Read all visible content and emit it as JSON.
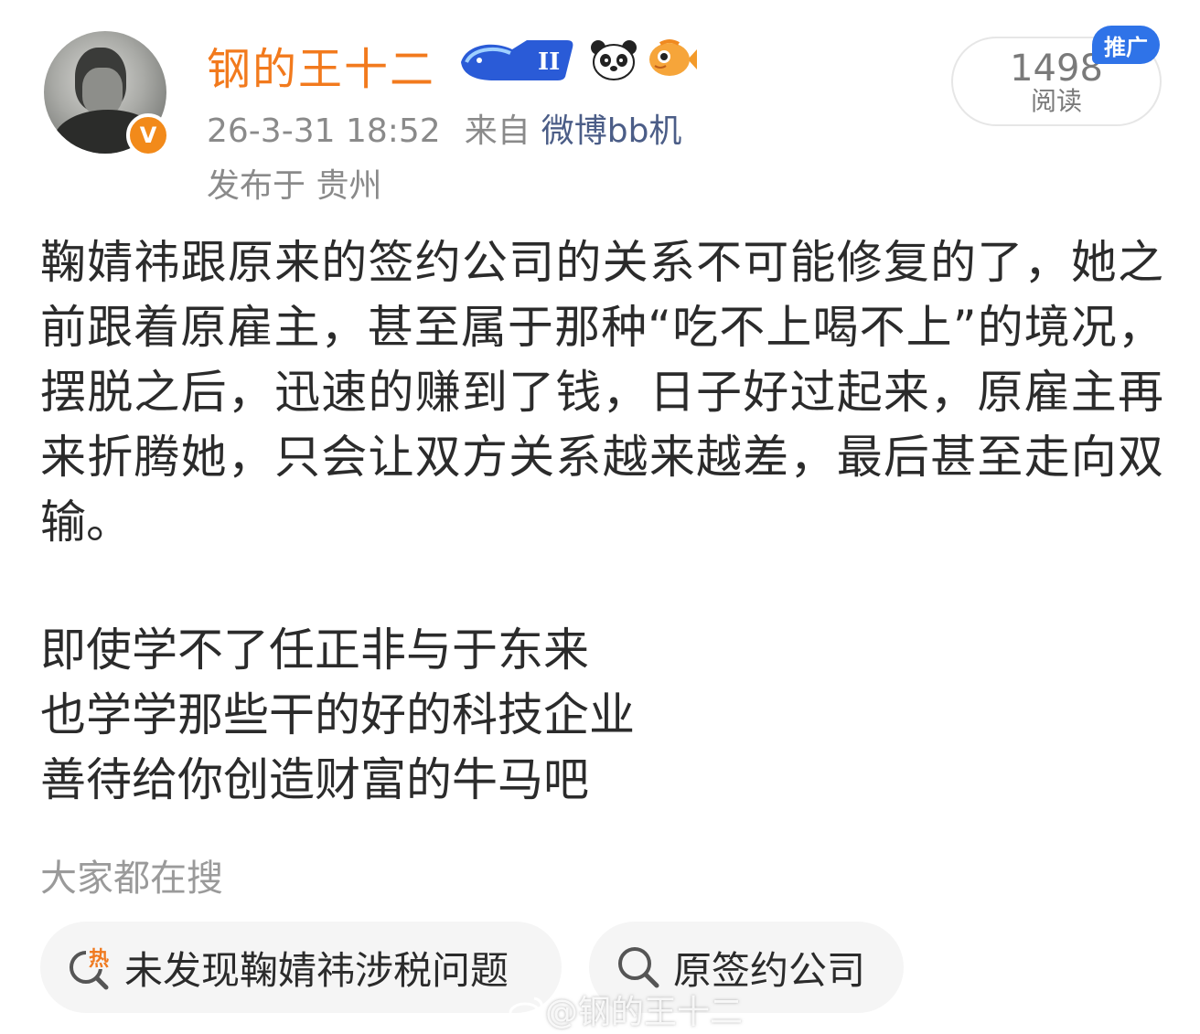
{
  "post": {
    "author": "钢的王十二",
    "time": "26-3-31 18:52",
    "from_prefix": "来自",
    "source": "微博bb机",
    "location": "发布于 贵州",
    "read_count": "1498",
    "read_label": "阅读",
    "promo_tag": "推广",
    "verified_badge": "V",
    "level_badge": "II",
    "paragraph": "鞠婧祎跟原来的签约公司的关系不可能修复的了，她之前跟着原雇主，甚至属于那种“吃不上喝不上”的境况，摆脱之后，迅速的赚到了钱，日子好过起来，原雇主再来折腾她，只会让双方关系越来越差，最后甚至走向双输。",
    "lines": [
      "即使学不了任正非与于东来",
      "也学学那些干的好的科技企业",
      "善待给你创造财富的牛马吧"
    ]
  },
  "trending": {
    "title": "大家都在搜",
    "hot_icon_text": "热",
    "chips": [
      {
        "label": "未发现鞠婧祎涉税问题",
        "icon": "hot-search-icon"
      },
      {
        "label": "原签约公司",
        "icon": "search-icon"
      }
    ]
  },
  "watermark": "@钢的王十二",
  "colors": {
    "username": "#f27a1d",
    "source_link": "#4b5d87",
    "promo_tag": "#2f73e8",
    "verified": "#f28a1a",
    "hot": "#f07a20"
  }
}
